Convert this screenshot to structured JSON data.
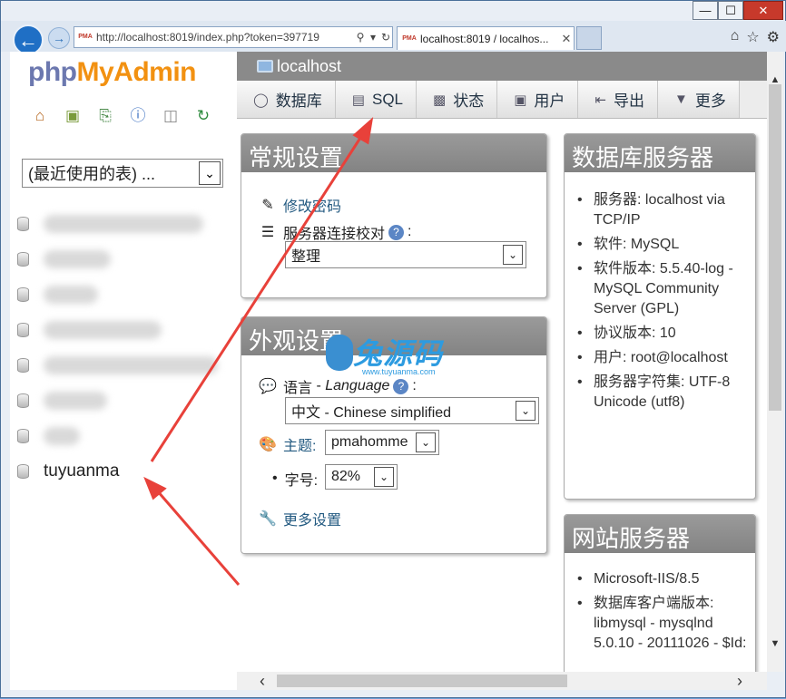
{
  "browser": {
    "url": "http://localhost:8019/index.php?token=397719",
    "tab_title": "localhost:8019 / localhos...",
    "favicon_text": "PMA",
    "window_controls": [
      "—",
      "☐",
      "✕"
    ],
    "browser_icons": [
      "home-icon",
      "star-icon",
      "gear-icon"
    ]
  },
  "sidebar": {
    "logo": {
      "php": "php",
      "my": "My",
      "admin": "Admin"
    },
    "quick_icons": [
      "home-icon",
      "exit-icon",
      "sql-icon",
      "help-icon",
      "docs-icon",
      "reload-icon"
    ],
    "recent_tables": "(最近使用的表) ...",
    "databases": [
      {
        "name": "",
        "blurred": true
      },
      {
        "name": "",
        "blurred": true
      },
      {
        "name": "",
        "blurred": true
      },
      {
        "name": "",
        "blurred": true
      },
      {
        "name": "",
        "blurred": true
      },
      {
        "name": "",
        "blurred": true
      },
      {
        "name": "",
        "blurred": true
      },
      {
        "name": "tuyuanma",
        "blurred": false
      }
    ]
  },
  "server": {
    "name": "localhost"
  },
  "menu": {
    "items": [
      {
        "label": "数据库",
        "icon": "database-icon"
      },
      {
        "label": "SQL",
        "icon": "sql-icon"
      },
      {
        "label": "状态",
        "icon": "status-icon"
      },
      {
        "label": "用户",
        "icon": "users-icon"
      },
      {
        "label": "导出",
        "icon": "export-icon"
      },
      {
        "label": "更多",
        "icon": "chevron-down-icon"
      }
    ]
  },
  "general_settings": {
    "title": "常规设置",
    "change_password": "修改密码",
    "collation_label": "服务器连接校对",
    "colon": ":",
    "collation_value": "整理"
  },
  "appearance_settings": {
    "title": "外观设置",
    "language_label": "语言",
    "language_sep": " - ",
    "language_en": "Language",
    "colon": ":",
    "language_value": "中文 - Chinese simplified",
    "theme_label": "主题:",
    "theme_value": "pmahomme",
    "fontsize_label": "字号:",
    "fontsize_value": "82%",
    "more_settings": "更多设置"
  },
  "db_server": {
    "title": "数据库服务器",
    "items": [
      "服务器: localhost via TCP/IP",
      "软件: MySQL",
      "软件版本: 5.5.40-log - MySQL Community Server (GPL)",
      "协议版本: 10",
      "用户: root@localhost",
      "服务器字符集: UTF-8 Unicode (utf8)"
    ]
  },
  "web_server": {
    "title": "网站服务器",
    "items": [
      "Microsoft-IIS/8.5",
      "数据库客户端版本: libmysql - mysqlnd 5.0.10 - 20111026 - $Id:"
    ]
  },
  "watermark": {
    "main": "兔源码",
    "sub": "www.tuyuanma.com"
  },
  "colors": {
    "accent": "#235a81",
    "arrow": "#e8413a",
    "header": "#8a8a8a"
  }
}
